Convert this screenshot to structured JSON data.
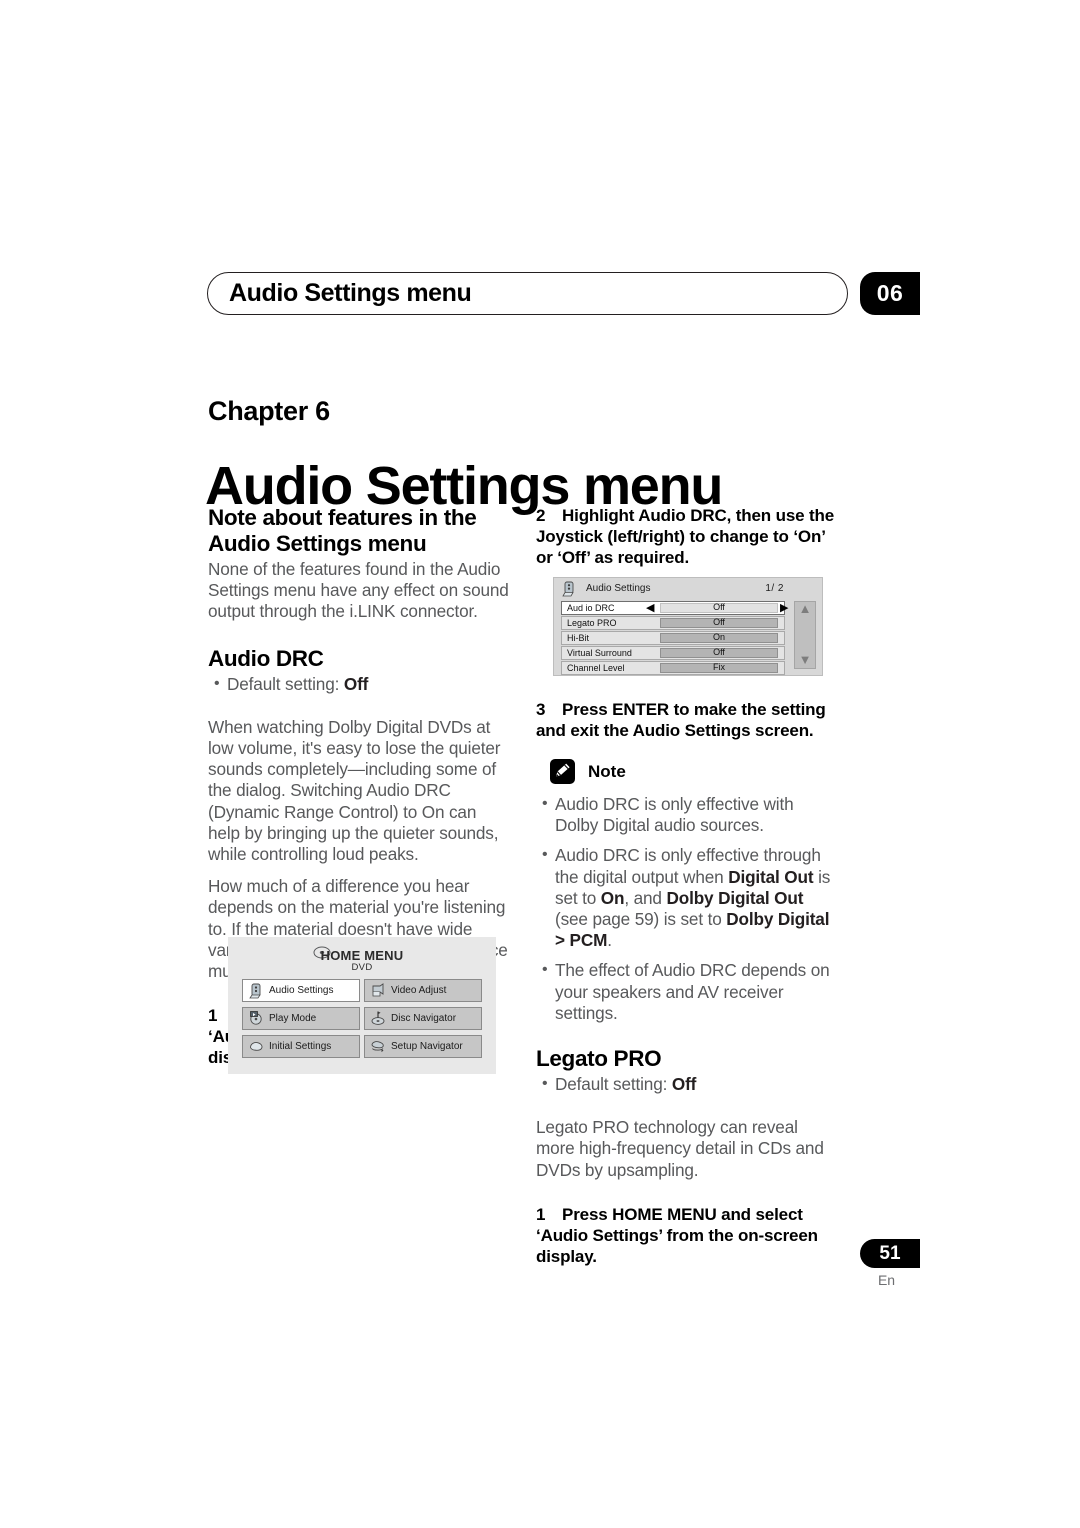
{
  "header": {
    "running_title": "Audio Settings menu",
    "chapter_badge": "06"
  },
  "chapter": {
    "label": "Chapter 6",
    "title": "Audio Settings menu"
  },
  "left_column": {
    "note_heading": "Note about features in the Audio Settings menu",
    "note_body": "None of the features found in the Audio Settings menu have any effect on sound output through the i.LINK connector.",
    "audio_drc_heading": "Audio DRC",
    "audio_drc_default": "Default setting: ",
    "audio_drc_default_value": "Off",
    "audio_drc_para1": "When watching Dolby Digital DVDs at low volume, it's easy to lose the quieter sounds completely—including some of the dialog. Switching Audio DRC (Dynamic Range Control) to On can help by bringing up the quieter sounds, while controlling loud peaks.",
    "audio_drc_para2": "How much of a difference you hear depends on the material you're listening to. If the material doesn't have wide variations in volume, you may not notice much change.",
    "step1_num": "1",
    "step1_text": "Press HOME MENU and select ‘Audio Settings’ from the on-screen display."
  },
  "home_menu_graphic": {
    "title": "HOME MENU",
    "subtitle": "DVD",
    "disc_icon": "disc-icon",
    "buttons": [
      {
        "label": "Audio Settings",
        "icon": "audio-settings-icon",
        "selected": true
      },
      {
        "label": "Video Adjust",
        "icon": "video-adjust-icon",
        "selected": false
      },
      {
        "label": "Play Mode",
        "icon": "play-mode-icon",
        "selected": false
      },
      {
        "label": "Disc Navigator",
        "icon": "disc-navigator-icon",
        "selected": false
      },
      {
        "label": "Initial Settings",
        "icon": "initial-settings-icon",
        "selected": false
      },
      {
        "label": "Setup Navigator",
        "icon": "setup-navigator-icon",
        "selected": false
      }
    ]
  },
  "right_column": {
    "step2_num": "2",
    "step2_text": "Highlight Audio DRC, then use the Joystick (left/right) to change to ‘On’ or ‘Off’ as required.",
    "step3_num": "3",
    "step3_text": "Press ENTER to make the setting and exit the Audio Settings screen.",
    "note_label": "Note",
    "note_icon": "pencil-note-icon",
    "note_bullets": [
      {
        "parts": [
          {
            "t": "Audio DRC is only effective with Dolby Digital audio sources.",
            "b": false
          }
        ]
      },
      {
        "parts": [
          {
            "t": "Audio DRC is only effective through the digital output when ",
            "b": false
          },
          {
            "t": "Digital Out",
            "b": true
          },
          {
            "t": " is set to ",
            "b": false
          },
          {
            "t": "On",
            "b": true
          },
          {
            "t": ", and ",
            "b": false
          },
          {
            "t": "Dolby Digital Out",
            "b": true
          },
          {
            "t": " (see page 59) is set to ",
            "b": false
          },
          {
            "t": "Dolby Digital > PCM",
            "b": true
          },
          {
            "t": ".",
            "b": false
          }
        ]
      },
      {
        "parts": [
          {
            "t": "The effect of Audio DRC depends on your speakers and AV receiver settings.",
            "b": false
          }
        ]
      }
    ],
    "legato_heading": "Legato PRO",
    "legato_default": "Default setting: ",
    "legato_default_value": "Off",
    "legato_body": "Legato PRO technology can reveal more high-frequency detail in CDs and DVDs by upsampling.",
    "legato_step1_num": "1",
    "legato_step1_text": "Press HOME MENU and select ‘Audio Settings’ from the on-screen display."
  },
  "audio_settings_graphic": {
    "icon": "audio-settings-icon",
    "title": "Audio Settings",
    "page_indicator": "1/ 2",
    "left_arrow": "◀",
    "right_arrow": "▶",
    "scroll_up": "▲",
    "scroll_down": "▼",
    "rows": [
      {
        "name": "Aud io DRC",
        "value": "Off",
        "active": true
      },
      {
        "name": "Legato PRO",
        "value": "Off",
        "active": false
      },
      {
        "name": "Hi-Bit",
        "value": "On",
        "active": false
      },
      {
        "name": "Virtual Surround",
        "value": "Off",
        "active": false
      },
      {
        "name": "Channel Level",
        "value": "Fix",
        "active": false
      }
    ]
  },
  "footer": {
    "page_number": "51",
    "language": "En"
  }
}
